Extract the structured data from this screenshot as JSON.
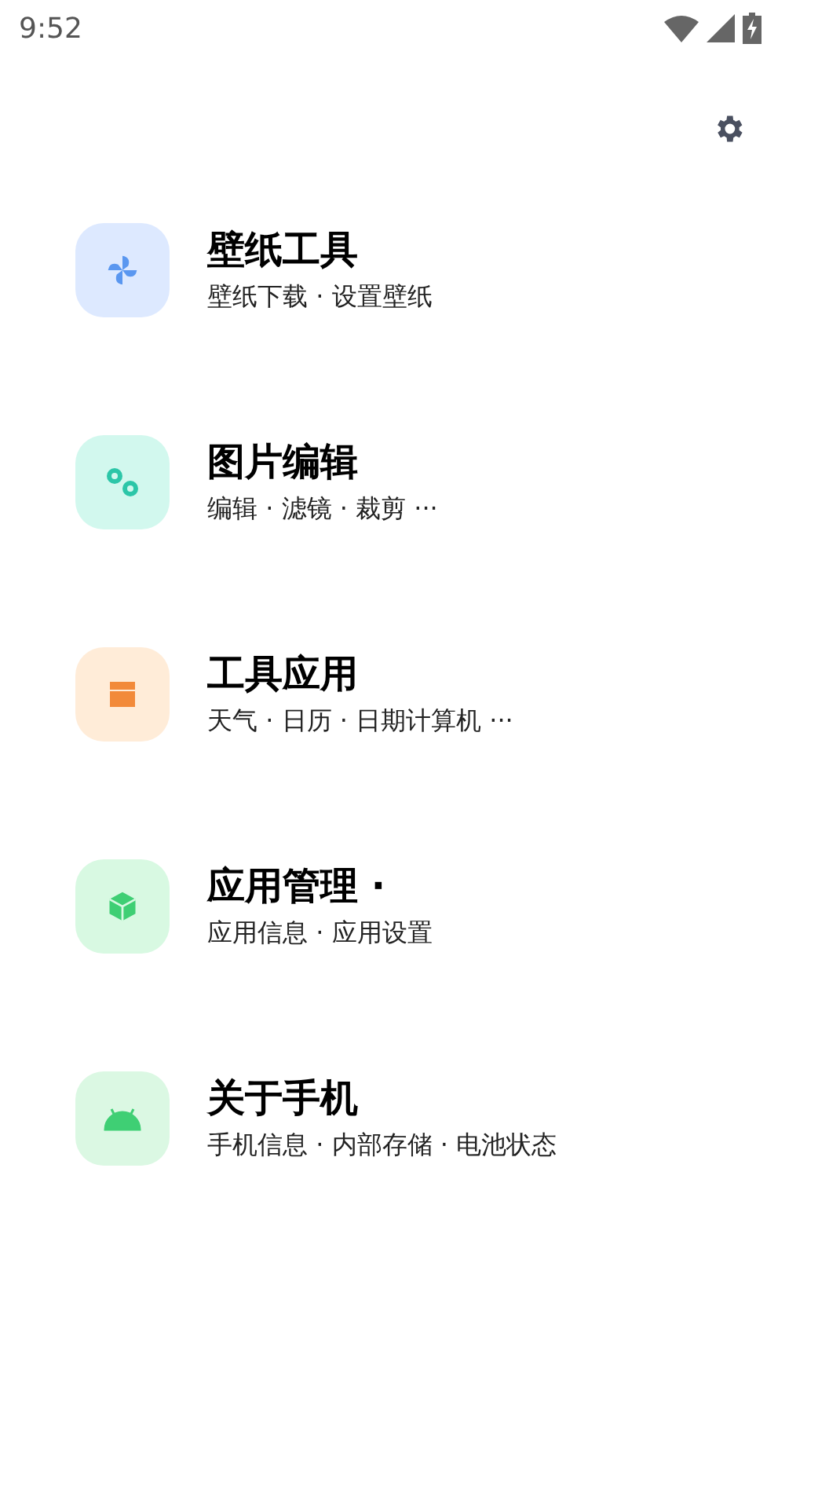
{
  "status_bar": {
    "time": "9:52"
  },
  "items": [
    {
      "kind": "pinwheel",
      "color": "#dde9ff",
      "title": "壁纸工具",
      "subtitle": "壁纸下载 · 设置壁纸"
    },
    {
      "kind": "gears",
      "color": "#d2f8ee",
      "title": "图片编辑",
      "subtitle": "编辑 · 滤镜 · 裁剪 ···"
    },
    {
      "kind": "box",
      "color": "#ffecd8",
      "title": "工具应用",
      "subtitle": "天气 · 日历 · 日期计算机 ···"
    },
    {
      "kind": "cube",
      "color": "#d8f9e2",
      "title": "应用管理 ·",
      "subtitle": "应用信息 · 应用设置"
    },
    {
      "kind": "android",
      "color": "#dbf8e3",
      "title": "关于手机",
      "subtitle": "手机信息 · 内部存储 · 电池状态"
    }
  ]
}
